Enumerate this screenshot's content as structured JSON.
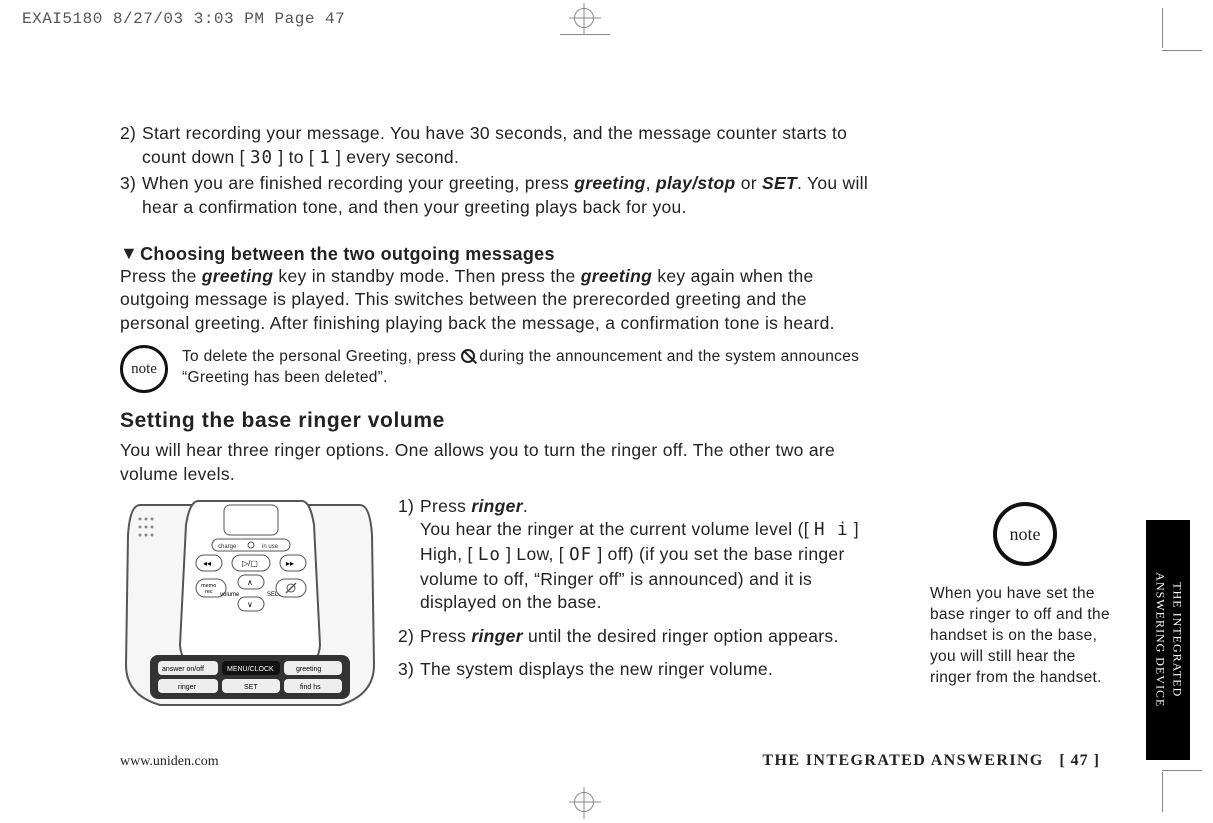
{
  "print_header": "EXAI5180  8/27/03 3:03 PM  Page 47",
  "steps_top": {
    "s2_a": "Start recording your message. You have 30 seconds, and the message counter starts to count down [ ",
    "s2_seg1": "30",
    "s2_b": " ] to [ ",
    "s2_seg2": "1",
    "s2_c": " ] every second.",
    "s3_a": "When you are finished recording your greeting, press ",
    "s3_k1": "greeting",
    "s3_b": ", ",
    "s3_k2": "play/stop",
    "s3_c": " or ",
    "s3_k3": "SET",
    "s3_d": ". You will hear a confirmation tone, and then your greeting plays back for you."
  },
  "sub_heading": "Choosing between the two outgoing messages",
  "sub_para_a": "Press the ",
  "sub_k1": "greeting",
  "sub_para_b": " key in standby mode. Then press the ",
  "sub_k2": "greeting",
  "sub_para_c": " key again when the outgoing message is played. This switches between the prerecorded greeting and the personal greeting. After finishing playing back the message, a confirmation tone is heard.",
  "note_label": "note",
  "note_inline_a": "To delete the personal Greeting, press ",
  "note_inline_b": " during the announcement and the system announces “Greeting has been deleted”.",
  "section_heading": "Setting the base ringer volume",
  "section_intro": "You will hear three ringer options. One allows you to turn the ringer off. The other two are volume levels.",
  "device_labels": {
    "charge": "charge",
    "in_use": "in use",
    "memo_rec": "memo\nrec",
    "volume": "volume",
    "select": "SELECT",
    "answer": "answer on/off",
    "menu": "MENU/CLOCK",
    "greeting": "greeting",
    "ringer": "ringer",
    "set": "SET",
    "find": "find hs"
  },
  "lower_steps": {
    "s1_a": "Press ",
    "s1_k": "ringer",
    "s1_b": ".",
    "s1_body_a": "You hear the ringer at the current volume level ([ ",
    "s1_hi": "H i",
    "s1_body_b": " ] High, [ ",
    "s1_lo": "Lo",
    "s1_body_c": " ] Low, [ ",
    "s1_of": "OF",
    "s1_body_d": " ] off) (if you set the base ringer volume to off, “Ringer off” is announced) and it is displayed on the base.",
    "s2_a": "Press ",
    "s2_k": "ringer",
    "s2_b": " until the desired ringer option appears.",
    "s3": "The system displays the new ringer volume."
  },
  "side_note": "When you have set the base ringer to off and the handset is on the base, you will still hear the ringer from the handset.",
  "edge_tab_line1": "THE INTEGRATED",
  "edge_tab_line2": "ANSWERING DEVICE",
  "footer": {
    "url": "www.uniden.com",
    "title": "THE INTEGRATED ANSWERING",
    "page": "[ 47 ]"
  }
}
